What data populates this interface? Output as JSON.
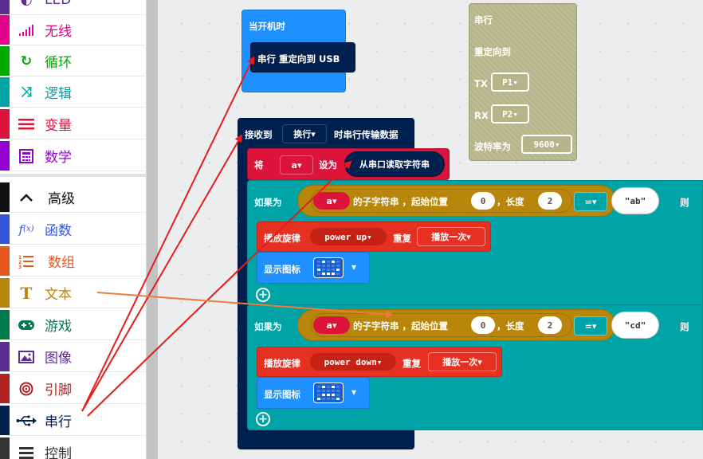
{
  "toolbox": {
    "categories": [
      {
        "label": "LED",
        "color": "#5c2d91",
        "icon": "toggle-icon"
      },
      {
        "label": "无线",
        "color": "#e3008c",
        "icon": "signal-icon"
      },
      {
        "label": "循环",
        "color": "#00aa00",
        "icon": "loop-icon"
      },
      {
        "label": "逻辑",
        "color": "#00a4a6",
        "icon": "shuffle-icon"
      },
      {
        "label": "变量",
        "color": "#dc143c",
        "icon": "lines-icon"
      },
      {
        "label": "数学",
        "color": "#9400d3",
        "icon": "calculator-icon"
      },
      {
        "label": "高级",
        "color": "#000000",
        "icon": "chevron-up-icon"
      },
      {
        "label": "函数",
        "color": "#3455db",
        "icon": "function-icon"
      },
      {
        "label": "数组",
        "color": "#e65722",
        "icon": "list-icon"
      },
      {
        "label": "文本",
        "color": "#b8860b",
        "icon": "text-icon"
      },
      {
        "label": "游戏",
        "color": "#007a4b",
        "icon": "gamepad-icon"
      },
      {
        "label": "图像",
        "color": "#5c2d91",
        "icon": "image-icon"
      },
      {
        "label": "引脚",
        "color": "#b22222",
        "icon": "target-icon"
      },
      {
        "label": "串行",
        "color": "#002050",
        "icon": "usb-icon"
      },
      {
        "label": "控制",
        "color": "#333333",
        "icon": "stack-icon"
      }
    ]
  },
  "blocks": {
    "on_start": {
      "label": "当开机时",
      "inner": "串行 重定向到 USB"
    },
    "serial_redirect": {
      "title": "串行",
      "subtitle": "重定向到",
      "tx_label": "TX",
      "tx_value": "P1",
      "rx_label": "RX",
      "rx_value": "P2",
      "baud_label": "波特率为",
      "baud_value": "9600"
    },
    "on_received": {
      "prefix": "接收到",
      "delimiter": "换行",
      "suffix": "时串行传输数据"
    },
    "set_var": {
      "label": "将",
      "var": "a",
      "mid": "设为",
      "value": "从串口读取字符串"
    },
    "if1": {
      "label": "如果为",
      "var": "a",
      "substr": "的子字符串 ，起始位置",
      "start": "0",
      "len_label": "，长度",
      "len": "2",
      "op": "=",
      "str": "\"ab\"",
      "then": "则"
    },
    "melody1": {
      "label": "播放旋律",
      "tune": "power up",
      "repeat_label": "重复",
      "repeat": "播放一次"
    },
    "show_icon1": {
      "label": "显示图标"
    },
    "if2": {
      "label": "如果为",
      "var": "a",
      "substr": "的子字符串 ，起始位置",
      "start": "0",
      "len_label": "，长度",
      "len": "2",
      "op": "=",
      "str": "\"cd\"",
      "then": "则"
    },
    "melody2": {
      "label": "播放旋律",
      "tune": "power down",
      "repeat_label": "重复",
      "repeat": "播放一次"
    },
    "show_icon2": {
      "label": "显示图标"
    }
  },
  "colors": {
    "serial": "#002050",
    "start_event": "#1e90ff",
    "variables": "#dc143c",
    "logic": "#00a4a6",
    "text": "#b8860b",
    "music": "#e63022",
    "basic": "#1e90ff",
    "annotation_red": "#e81b1b",
    "annotation_orange": "#f07c3c"
  }
}
